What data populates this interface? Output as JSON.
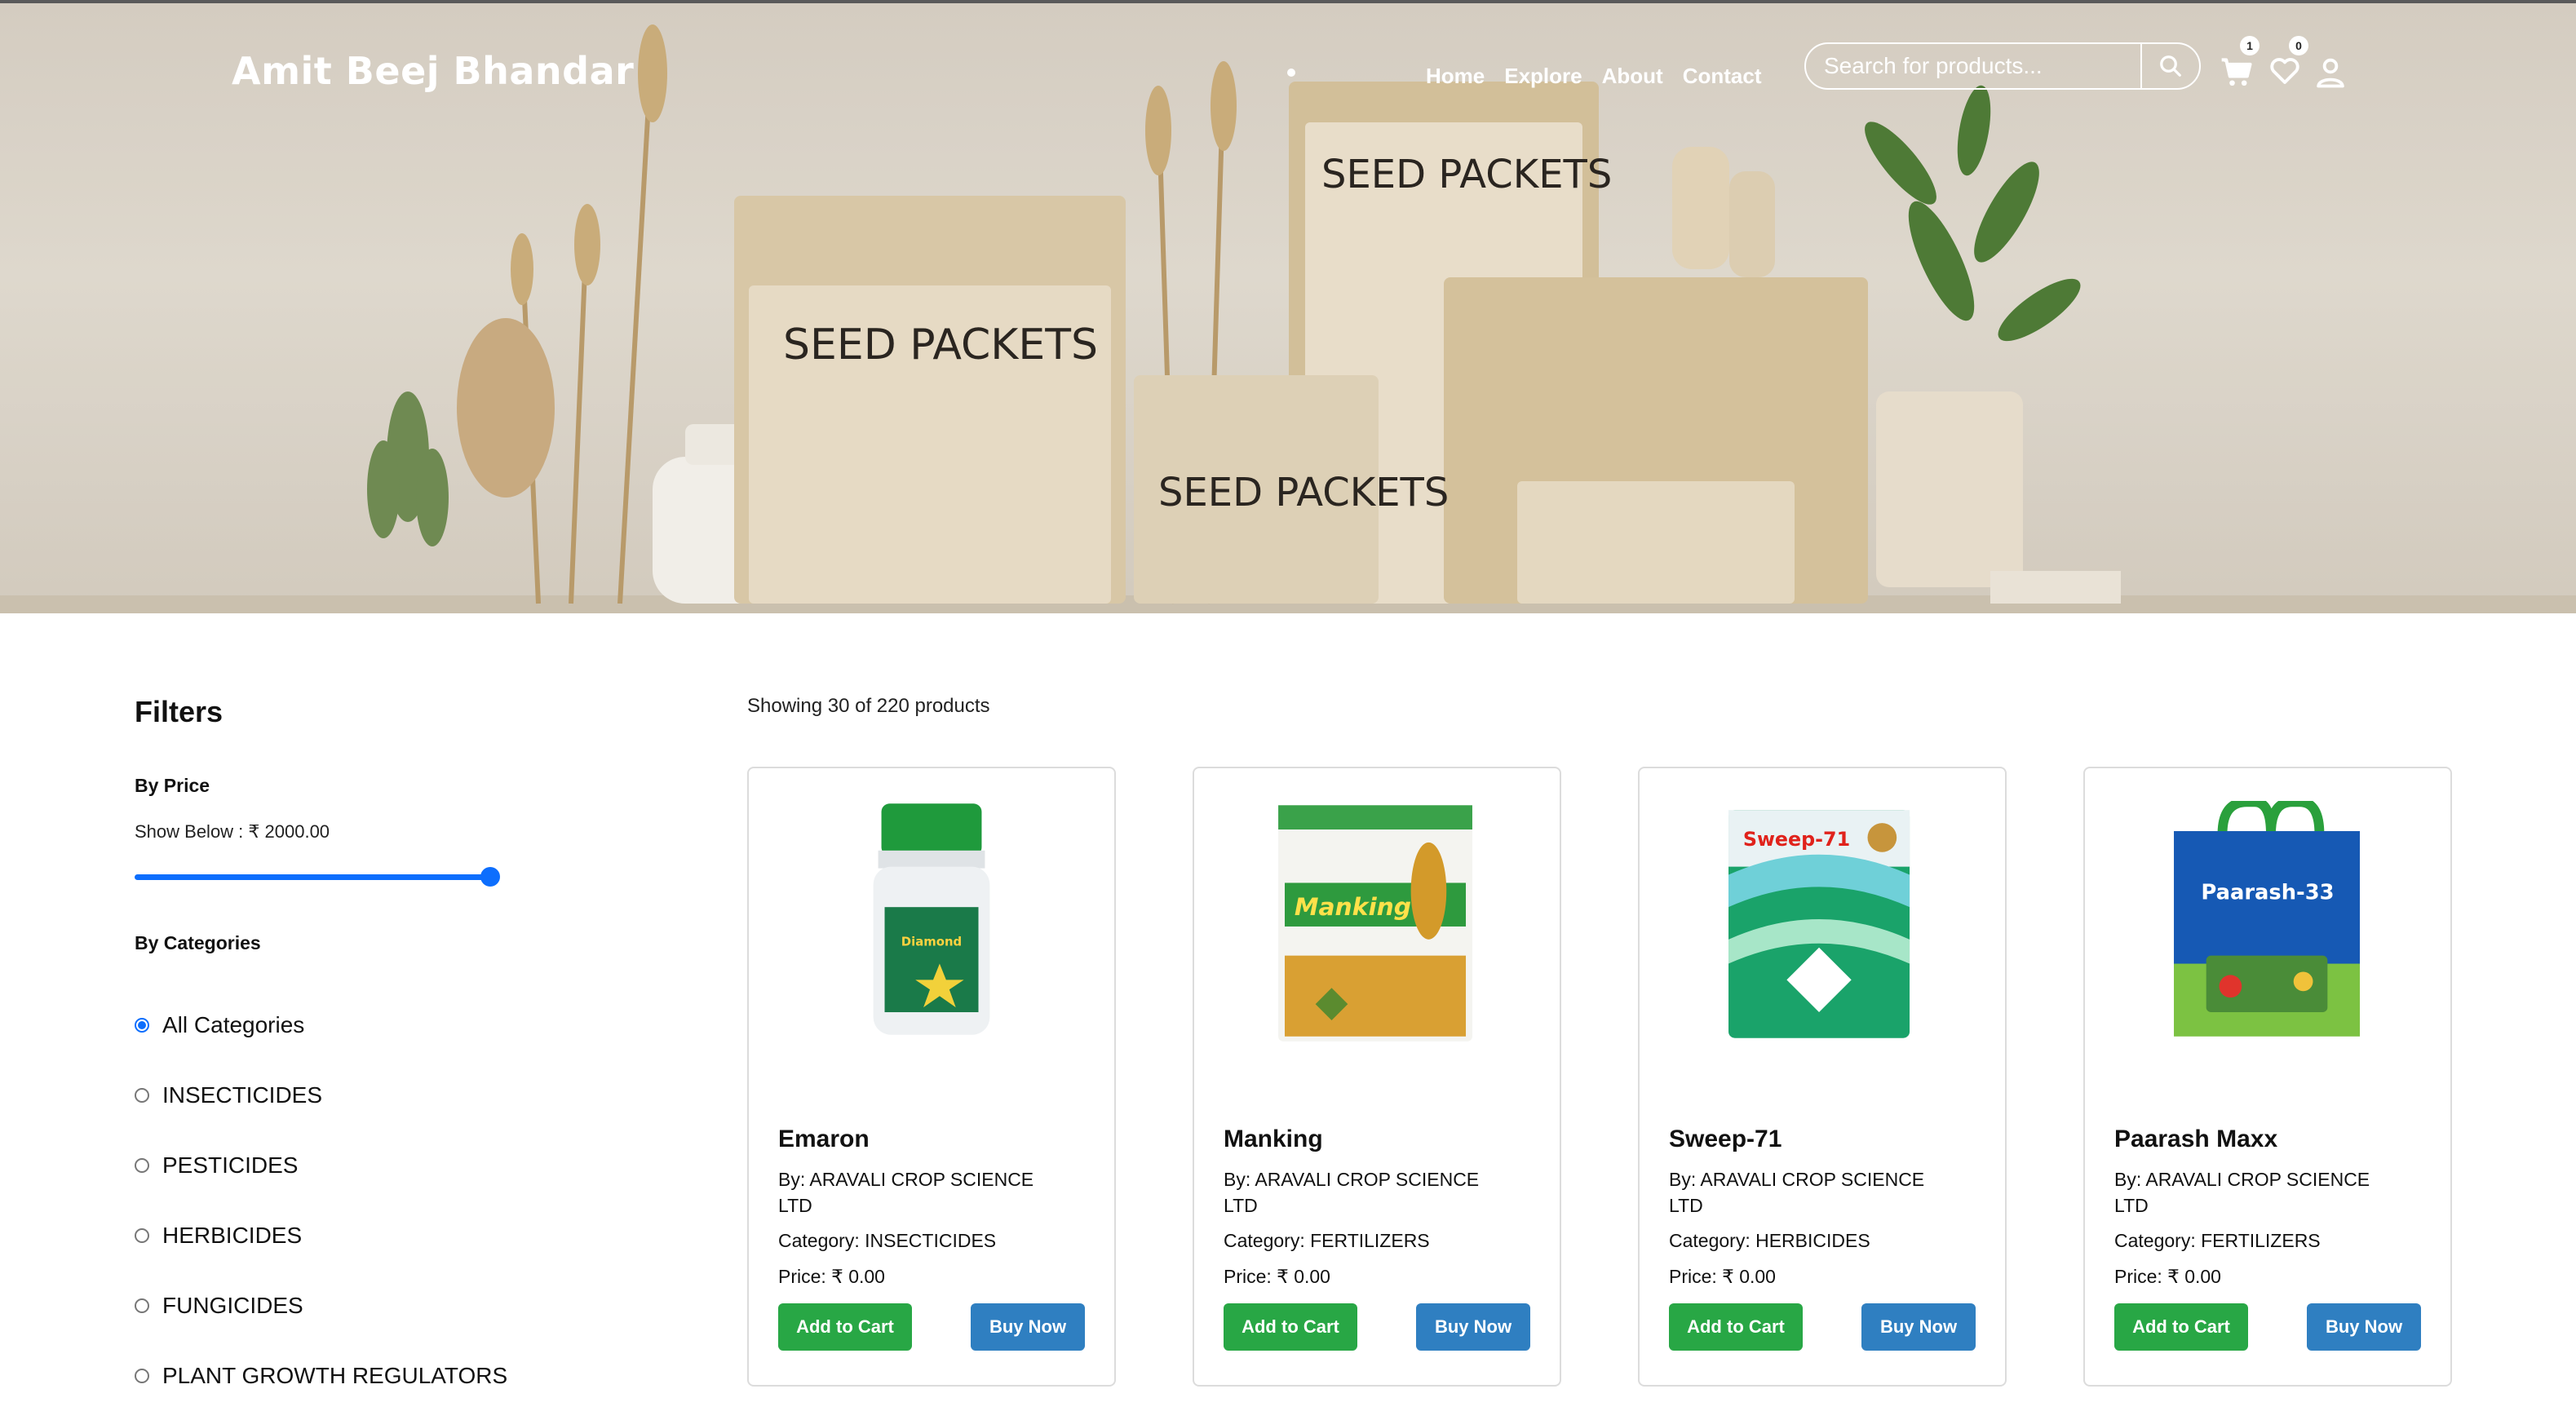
{
  "header": {
    "brand": "Amit Beej Bhandar",
    "nav": [
      "Home",
      "Explore",
      "About",
      "Contact"
    ],
    "search_placeholder": "Search for products...",
    "cart_count": "1",
    "wishlist_count": "0"
  },
  "hero": {
    "packet_text_1": "SEED PACKETS",
    "packet_text_2": "SEED PACKETS",
    "packet_text_3": "SEED PACKETS"
  },
  "filters": {
    "title": "Filters",
    "price_heading": "By Price",
    "price_text": "Show Below : ₹ 2000.00",
    "price_max_fraction": 1.0,
    "categories_heading": "By Categories",
    "categories": [
      "All Categories",
      "INSECTICIDES",
      "PESTICIDES",
      "HERBICIDES",
      "FUNGICIDES",
      "PLANT GROWTH REGULATORS"
    ],
    "selected_category": "All Categories"
  },
  "listing": {
    "showing": "Showing 30 of 220 products",
    "products": [
      {
        "name": "Emaron",
        "by": "By: ARAVALI CROP SCIENCE LTD",
        "category": "Category: INSECTICIDES",
        "price": "Price: ₹ 0.00",
        "cart_label": "Add to Cart",
        "buy_label": "Buy Now",
        "image_label": "Diamond"
      },
      {
        "name": "Manking",
        "by": "By: ARAVALI CROP SCIENCE LTD",
        "category": "Category: FERTILIZERS",
        "price": "Price: ₹ 0.00",
        "cart_label": "Add to Cart",
        "buy_label": "Buy Now",
        "image_label": "Manking"
      },
      {
        "name": "Sweep-71",
        "by": "By: ARAVALI CROP SCIENCE LTD",
        "category": "Category: HERBICIDES",
        "price": "Price: ₹ 0.00",
        "cart_label": "Add to Cart",
        "buy_label": "Buy Now",
        "image_label": "Sweep-71"
      },
      {
        "name": "Paarash Maxx",
        "by": "By: ARAVALI CROP SCIENCE LTD",
        "category": "Category: FERTILIZERS",
        "price": "Price: ₹ 0.00",
        "cart_label": "Add to Cart",
        "buy_label": "Buy Now",
        "image_label": "Paarash-33"
      }
    ]
  },
  "colors": {
    "accent": "#0d6efd",
    "add_to_cart": "#28a745",
    "buy_now": "#2f7fc1"
  }
}
